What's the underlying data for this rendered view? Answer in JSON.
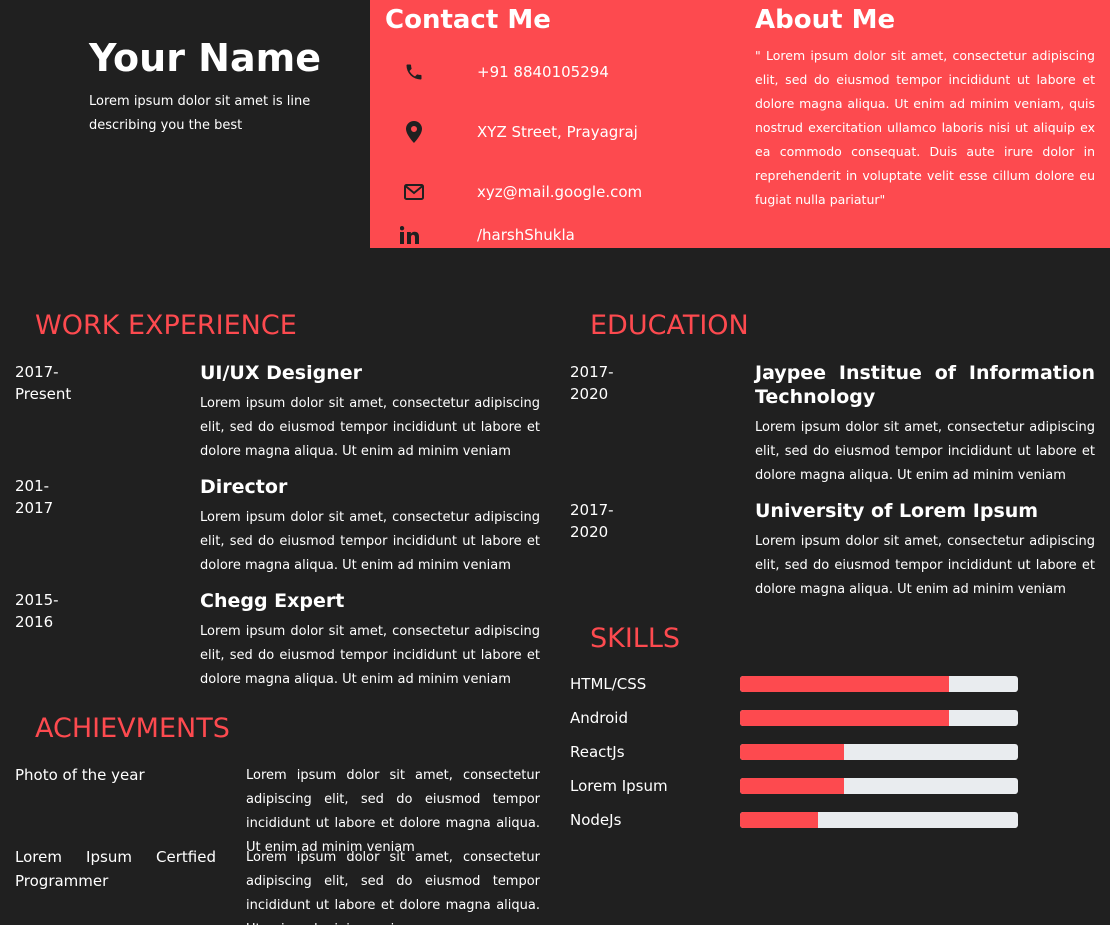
{
  "header": {
    "name": "Your Name",
    "tagline": "Lorem ipsum dolor sit amet is line describing you the best"
  },
  "contact": {
    "title": "Contact Me",
    "items": [
      {
        "icon": "phone-icon",
        "text": "+91 8840105294"
      },
      {
        "icon": "location-pin-icon",
        "text": "XYZ Street, Prayagraj"
      },
      {
        "icon": "envelope-icon",
        "text": "xyz@mail.google.com"
      },
      {
        "icon": "linkedin-icon",
        "text": "/harshShukla"
      }
    ]
  },
  "about": {
    "title": "About Me",
    "text": "\" Lorem ipsum dolor sit amet, consectetur adipiscing elit, sed do eiusmod tempor incididunt ut labore et dolore magna aliqua. Ut enim ad minim veniam, quis nostrud exercitation ullamco laboris nisi ut aliquip ex ea commodo consequat. Duis aute irure dolor in reprehenderit in voluptate velit esse cillum dolore eu fugiat nulla pariatur\""
  },
  "work": {
    "title": "WORK EXPERIENCE",
    "items": [
      {
        "date": "2017-Present",
        "role": "UI/UX Designer",
        "desc": "Lorem ipsum dolor sit amet, consectetur adipiscing elit, sed do eiusmod tempor incididunt ut labore et dolore magna aliqua. Ut enim ad minim veniam"
      },
      {
        "date": "201-2017",
        "role": "Director",
        "desc": "Lorem ipsum dolor sit amet, consectetur adipiscing elit, sed do eiusmod tempor incididunt ut labore et dolore magna aliqua. Ut enim ad minim veniam"
      },
      {
        "date": "2015-2016",
        "role": "Chegg Expert",
        "desc": "Lorem ipsum dolor sit amet, consectetur adipiscing elit, sed do eiusmod tempor incididunt ut labore et dolore magna aliqua. Ut enim ad minim veniam"
      }
    ]
  },
  "education": {
    "title": "EDUCATION",
    "items": [
      {
        "date": "2017-2020",
        "role": "Jaypee Institue of Information Technology",
        "desc": "Lorem ipsum dolor sit amet, consectetur adipiscing elit, sed do eiusmod tempor incididunt ut labore et dolore magna aliqua. Ut enim ad minim veniam"
      },
      {
        "date": "2017-2020",
        "role": "University of Lorem Ipsum",
        "desc": "Lorem ipsum dolor sit amet, consectetur adipiscing elit, sed do eiusmod tempor incididunt ut labore et dolore magna aliqua. Ut enim ad minim veniam"
      }
    ]
  },
  "achievements": {
    "title": "ACHIEVMENTS",
    "items": [
      {
        "title": "Photo of the year",
        "desc": "Lorem ipsum dolor sit amet, consectetur adipiscing elit, sed do eiusmod tempor incididunt ut labore et dolore magna aliqua. Ut enim ad minim veniam"
      },
      {
        "title": "Lorem Ipsum Certfied Programmer",
        "desc": "Lorem ipsum dolor sit amet, consectetur adipiscing elit, sed do eiusmod tempor incididunt ut labore et dolore magna aliqua. Ut enim ad minim veniam"
      }
    ]
  },
  "skills": {
    "title": "SKILLS",
    "items": [
      {
        "name": "HTML/CSS",
        "level": 0.75
      },
      {
        "name": "Android",
        "level": 0.75
      },
      {
        "name": "ReactJs",
        "level": 0.375
      },
      {
        "name": "Lorem Ipsum",
        "level": 0.375
      },
      {
        "name": "NodeJs",
        "level": 0.28
      }
    ]
  },
  "colors": {
    "accent": "#fd4a4f",
    "background": "#202020",
    "bar_track": "#e9ecef"
  }
}
